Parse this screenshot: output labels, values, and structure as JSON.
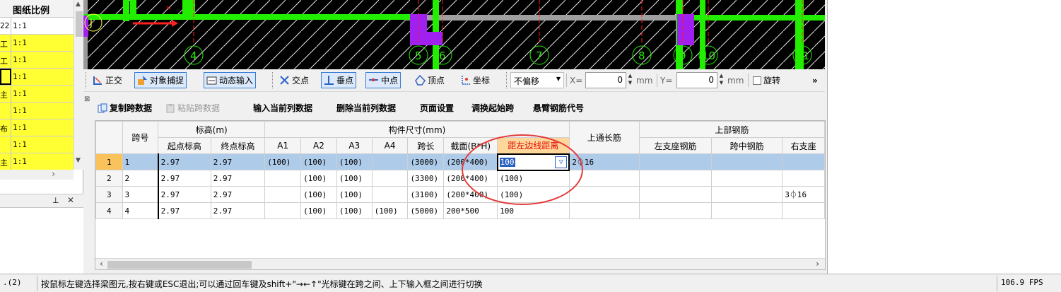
{
  "left_panel": {
    "header": "图纸比例",
    "rows": [
      {
        "name": "22",
        "scale": "1:1"
      },
      {
        "name": "工",
        "scale": "1:1"
      },
      {
        "name": "工",
        "scale": "1:1"
      },
      {
        "name": "",
        "scale": "1:1"
      },
      {
        "name": "主",
        "scale": "1:1"
      },
      {
        "name": "",
        "scale": "1:1"
      },
      {
        "name": "布",
        "scale": "1:1"
      },
      {
        "name": "",
        "scale": "1:1"
      },
      {
        "name": "主",
        "scale": "1:1"
      }
    ],
    "pin_icon": "pin-icon",
    "close_icon": "close-icon"
  },
  "cad": {
    "axis_labels": [
      "4",
      "5",
      "6",
      "7",
      "8",
      "9",
      "10",
      "11"
    ],
    "left_axis_label": "J",
    "colors": {
      "background": "#000000",
      "beam": "#22ee00",
      "column": "#a020f0",
      "axis": "#ff2020",
      "grey_beam": "#a0a0a0"
    }
  },
  "toolbar": {
    "orthogonal": "正交",
    "object_snap": "对象捕捉",
    "dynamic_input": "动态输入",
    "intersection": "交点",
    "perpendicular": "垂点",
    "midpoint": "中点",
    "vertex": "顶点",
    "coordinate": "坐标",
    "offset_mode": "不偏移",
    "x_label": "X=",
    "x_value": "0",
    "y_label": "Y=",
    "y_value": "0",
    "unit": "mm",
    "rotate": "旋转",
    "overflow": "»"
  },
  "table_toolbar": {
    "copy_span": "复制跨数据",
    "paste_span": "粘贴跨数据",
    "input_column": "输入当前列数据",
    "delete_column": "删除当前列数据",
    "page_setup": "页面设置",
    "swap_start_span": "调换起始跨",
    "cantilever_code": "悬臂钢筋代号"
  },
  "grid": {
    "headers_top": {
      "span_no": "跨号",
      "elevation": "标高(m)",
      "size": "构件尺寸(mm)",
      "top_long": "上通长筋",
      "top_rebar": "上部钢筋"
    },
    "headers_sub": {
      "start_elev": "起点标高",
      "end_elev": "终点标高",
      "a1": "A1",
      "a2": "A2",
      "a3": "A3",
      "a4": "A4",
      "span_len": "跨长",
      "section": "截面(B*H)",
      "edge_dist": "距左边线距离",
      "left_support": "左支座钢筋",
      "mid_span": "跨中钢筋",
      "right_support": "右支座"
    },
    "rows": [
      {
        "rn": "1",
        "span": "1",
        "start": "2.97",
        "end": "2.97",
        "a1": "(100)",
        "a2": "(100)",
        "a3": "(100)",
        "a4": "",
        "len": "(3000)",
        "section": "(200*400)",
        "dist": "100",
        "top_long": "2⏀16",
        "left": "",
        "mid": "",
        "right": ""
      },
      {
        "rn": "2",
        "span": "2",
        "start": "2.97",
        "end": "2.97",
        "a1": "",
        "a2": "(100)",
        "a3": "(100)",
        "a4": "",
        "len": "(3300)",
        "section": "(200*400)",
        "dist": "(100)",
        "top_long": "",
        "left": "",
        "mid": "",
        "right": ""
      },
      {
        "rn": "3",
        "span": "3",
        "start": "2.97",
        "end": "2.97",
        "a1": "",
        "a2": "(100)",
        "a3": "(100)",
        "a4": "",
        "len": "(3100)",
        "section": "(200*400)",
        "dist": "(100)",
        "top_long": "",
        "left": "",
        "mid": "",
        "right": "3⏀16"
      },
      {
        "rn": "4",
        "span": "4",
        "start": "2.97",
        "end": "2.97",
        "a1": "",
        "a2": "(100)",
        "a3": "(100)",
        "a4": "(100)",
        "len": "(5000)",
        "section": "200*500",
        "dist": "100",
        "top_long": "",
        "left": "",
        "mid": "",
        "right": ""
      }
    ],
    "dropdown_icon": "chevron-down-icon"
  },
  "statusbar": {
    "left": ".(2)",
    "message": "按鼠标左键选择梁图元,按右键或ESC退出;可以通过回车键及shift+\"→←↑\"光标键在跨之间、上下输入框之间进行切换",
    "fps": "106.9 FPS"
  }
}
